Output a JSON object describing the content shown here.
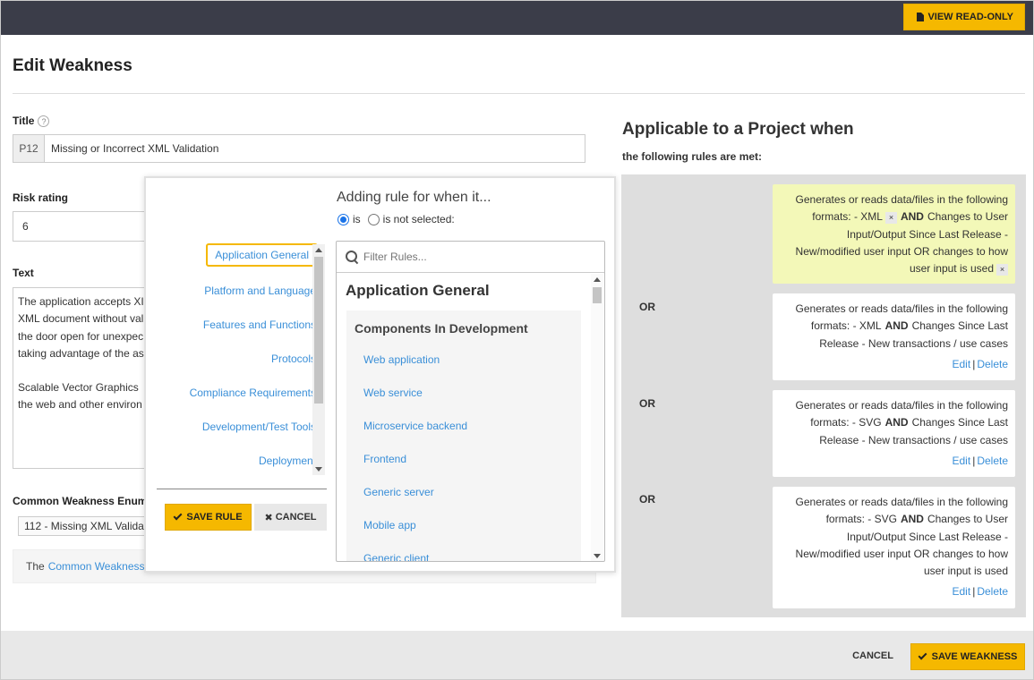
{
  "header": {
    "view_readonly_label": "VIEW READ-ONLY"
  },
  "page": {
    "title": "Edit Weakness"
  },
  "form": {
    "title_label": "Title",
    "title_help": "?",
    "title_prefix": "P12",
    "title_value": "Missing or Incorrect XML Validation",
    "risk_label": "Risk rating",
    "risk_value": "6",
    "text_label": "Text",
    "text_lines": [
      "The application accepts XI",
      "XML document without val",
      "the door open for unexpec",
      "taking advantage of the as"
    ],
    "text_lines_2": [
      "Scalable Vector Graphics",
      "the web and other environ"
    ],
    "cwe_label": "Common Weakness Enume",
    "cwe_value": "112 - Missing XML Valida",
    "cwe_note_prefix": "The",
    "cwe_note_link": "Common Weakness"
  },
  "applicable": {
    "title": "Applicable to a Project when",
    "subtitle": "the following rules are met:",
    "or_label": "OR",
    "rules": [
      {
        "lines": [
          "Generates or reads data/files in the following",
          "formats: - XML|x|AND|Changes to User",
          "Input/Output Since Last Release -",
          "New/modified user input OR changes to how",
          "user input is used|x"
        ],
        "line1": "Generates or reads data/files in the following",
        "line2a": "formats: - XML",
        "line2b": "Changes to User",
        "line3": "Input/Output Since Last Release -",
        "line4": "New/modified user input OR changes to how",
        "line5": "user input is used",
        "highlighted": true
      },
      {
        "line1": "Generates or reads data/files in the following",
        "line2a": "formats: - XML",
        "line2b": "Changes Since Last",
        "line3": "Release - New transactions / use cases"
      },
      {
        "line1": "Generates or reads data/files in the following",
        "line2a": "formats: - SVG",
        "line2b": "Changes Since Last",
        "line3": "Release - New transactions / use cases"
      },
      {
        "line1": "Generates or reads data/files in the following",
        "line2a": "formats: - SVG",
        "line2b": "Changes to User",
        "line3": "Input/Output Since Last Release -",
        "line4": "New/modified user input OR changes to how",
        "line5": "user input is used"
      }
    ],
    "and_label": "AND",
    "chip_x": "×",
    "edit_label": "Edit",
    "sep": "|",
    "delete_label": "Delete"
  },
  "modal": {
    "heading": "Adding rule for when it...",
    "radio_is": "is",
    "radio_is_not": "is not selected:",
    "categories": [
      "Application General",
      "Platform and Language",
      "Features and Functions",
      "Protocols",
      "Compliance Requirements",
      "Development/Test Tools",
      "Deployment"
    ],
    "filter_placeholder": "Filter Rules...",
    "group_title": "Application General",
    "subgroup_title": "Components In Development",
    "rule_items": [
      "Web application",
      "Web service",
      "Microservice backend",
      "Frontend",
      "Generic server",
      "Mobile app",
      "Generic client"
    ],
    "save_rule_label": "SAVE RULE",
    "cancel_label": "CANCEL"
  },
  "footer": {
    "cancel_label": "CANCEL",
    "save_label": "SAVE WEAKNESS"
  },
  "colors": {
    "accent": "#f5b800",
    "topbar": "#3b3d49",
    "link": "#3a8fd8",
    "highlight": "#f3f8b8"
  }
}
